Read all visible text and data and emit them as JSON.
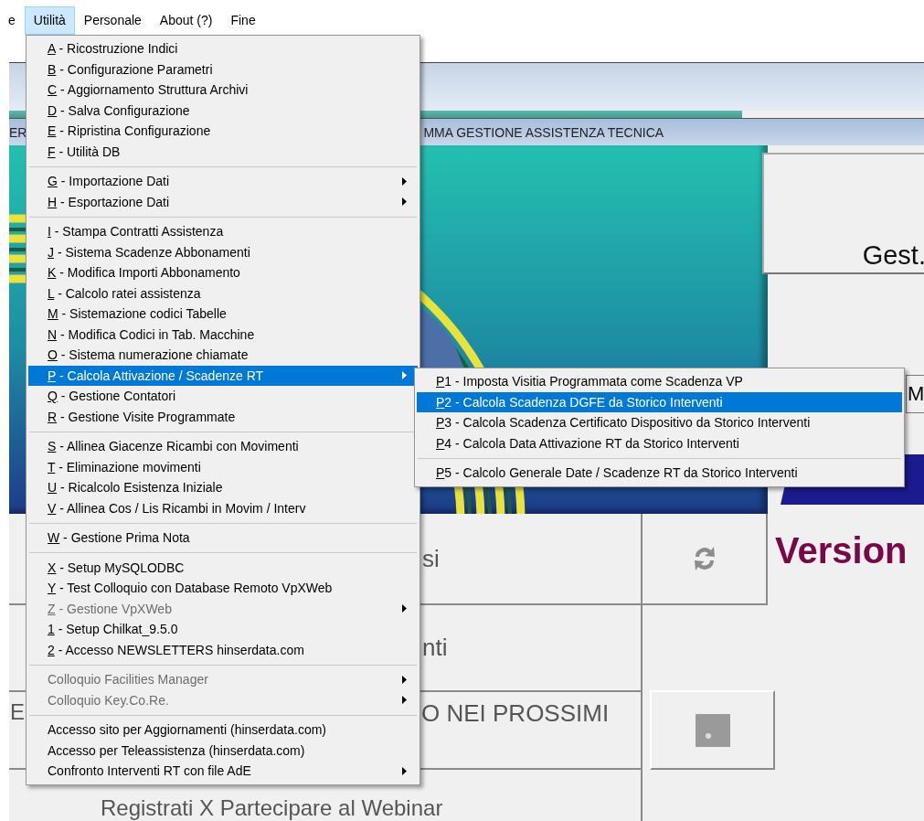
{
  "menubar": [
    {
      "label": "e",
      "selected": false
    },
    {
      "label": "Utilità",
      "selected": true
    },
    {
      "label": "Personale",
      "selected": false
    },
    {
      "label": "About (?)",
      "selected": false
    },
    {
      "label": "Fine",
      "selected": false
    }
  ],
  "background_window": {
    "title_left": "ER",
    "title_right": "MMA GESTIONE ASSISTENZA TECNICA",
    "panel_label": "Gest.",
    "side_label": "M",
    "version_label": "Version",
    "buttons": [
      {
        "kind": "text",
        "texts": [
          "si"
        ]
      },
      {
        "kind": "refresh"
      },
      {
        "kind": "text",
        "texts": [
          "nti"
        ]
      },
      {
        "kind": "text",
        "texts": [
          "E",
          "O NEI PROSSIMI"
        ]
      },
      {
        "kind": "picture"
      },
      {
        "kind": "text",
        "texts": [
          "Registrati X Partecipare al Webinar"
        ]
      }
    ]
  },
  "menu": {
    "items": [
      {
        "kind": "item",
        "label": "A - Ricostruzione Indici",
        "mnemonic": true,
        "disabled": false,
        "submenu": false,
        "selected": false
      },
      {
        "kind": "item",
        "label": "B - Configurazione Parametri",
        "mnemonic": true,
        "disabled": false,
        "submenu": false,
        "selected": false
      },
      {
        "kind": "item",
        "label": "C - Aggiornamento Struttura Archivi",
        "mnemonic": true,
        "disabled": false,
        "submenu": false,
        "selected": false
      },
      {
        "kind": "item",
        "label": "D - Salva Configurazione",
        "mnemonic": true,
        "disabled": false,
        "submenu": false,
        "selected": false
      },
      {
        "kind": "item",
        "label": "E - Ripristina Configurazione",
        "mnemonic": true,
        "disabled": false,
        "submenu": false,
        "selected": false
      },
      {
        "kind": "item",
        "label": "F - Utilità DB",
        "mnemonic": true,
        "disabled": false,
        "submenu": false,
        "selected": false
      },
      {
        "kind": "separator"
      },
      {
        "kind": "item",
        "label": "G - Importazione Dati",
        "mnemonic": true,
        "disabled": false,
        "submenu": true,
        "selected": false
      },
      {
        "kind": "item",
        "label": "H - Esportazione Dati",
        "mnemonic": true,
        "disabled": false,
        "submenu": true,
        "selected": false
      },
      {
        "kind": "separator"
      },
      {
        "kind": "item",
        "label": "I - Stampa Contratti Assistenza",
        "mnemonic": true,
        "disabled": false,
        "submenu": false,
        "selected": false
      },
      {
        "kind": "item",
        "label": "J - Sistema Scadenze Abbonamenti",
        "mnemonic": true,
        "disabled": false,
        "submenu": false,
        "selected": false
      },
      {
        "kind": "item",
        "label": "K - Modifica Importi Abbonamento",
        "mnemonic": true,
        "disabled": false,
        "submenu": false,
        "selected": false
      },
      {
        "kind": "item",
        "label": "L - Calcolo ratei assistenza",
        "mnemonic": true,
        "disabled": false,
        "submenu": false,
        "selected": false
      },
      {
        "kind": "item",
        "label": "M - Sistemazione codici Tabelle",
        "mnemonic": true,
        "disabled": false,
        "submenu": false,
        "selected": false
      },
      {
        "kind": "item",
        "label": "N - Modifica Codici in Tab. Macchine",
        "mnemonic": true,
        "disabled": false,
        "submenu": false,
        "selected": false
      },
      {
        "kind": "item",
        "label": "O - Sistema numerazione chiamate",
        "mnemonic": true,
        "disabled": false,
        "submenu": false,
        "selected": false
      },
      {
        "kind": "item",
        "label": "P - Calcola Attivazione / Scadenze RT",
        "mnemonic": true,
        "disabled": false,
        "submenu": true,
        "selected": true
      },
      {
        "kind": "item",
        "label": "Q - Gestione Contatori",
        "mnemonic": true,
        "disabled": false,
        "submenu": false,
        "selected": false
      },
      {
        "kind": "item",
        "label": "R - Gestione Visite Programmate",
        "mnemonic": true,
        "disabled": false,
        "submenu": false,
        "selected": false
      },
      {
        "kind": "separator"
      },
      {
        "kind": "item",
        "label": "S - Allinea Giacenze Ricambi con Movimenti",
        "mnemonic": true,
        "disabled": false,
        "submenu": false,
        "selected": false
      },
      {
        "kind": "item",
        "label": "T - Eliminazione movimenti",
        "mnemonic": true,
        "disabled": false,
        "submenu": false,
        "selected": false
      },
      {
        "kind": "item",
        "label": "U - Ricalcolo Esistenza Iniziale",
        "mnemonic": true,
        "disabled": false,
        "submenu": false,
        "selected": false
      },
      {
        "kind": "item",
        "label": "V - Allinea Cos / Lis Ricambi in Movim / Interv",
        "mnemonic": true,
        "disabled": false,
        "submenu": false,
        "selected": false
      },
      {
        "kind": "separator"
      },
      {
        "kind": "item",
        "label": "W - Gestione Prima Nota",
        "mnemonic": true,
        "disabled": false,
        "submenu": false,
        "selected": false
      },
      {
        "kind": "separator"
      },
      {
        "kind": "item",
        "label": "X - Setup MySQLODBC",
        "mnemonic": true,
        "disabled": false,
        "submenu": false,
        "selected": false
      },
      {
        "kind": "item",
        "label": "Y - Test Colloquio con Database Remoto VpXWeb",
        "mnemonic": true,
        "disabled": false,
        "submenu": false,
        "selected": false
      },
      {
        "kind": "item",
        "label": "Z - Gestione VpXWeb",
        "mnemonic": true,
        "disabled": true,
        "submenu": true,
        "selected": false
      },
      {
        "kind": "item",
        "label": "1 - Setup Chilkat_9.5.0",
        "mnemonic": true,
        "disabled": false,
        "submenu": false,
        "selected": false
      },
      {
        "kind": "item",
        "label": "2 - Accesso NEWSLETTERS hinserdata.com",
        "mnemonic": true,
        "disabled": false,
        "submenu": false,
        "selected": false
      },
      {
        "kind": "separator"
      },
      {
        "kind": "item",
        "label": "Colloquio Facilities Manager",
        "mnemonic": false,
        "disabled": true,
        "submenu": true,
        "selected": false
      },
      {
        "kind": "item",
        "label": "Colloquio Key.Co.Re.",
        "mnemonic": false,
        "disabled": true,
        "submenu": true,
        "selected": false
      },
      {
        "kind": "separator"
      },
      {
        "kind": "item",
        "label": "Accesso sito per Aggiornamenti (hinserdata.com)",
        "mnemonic": false,
        "disabled": false,
        "submenu": false,
        "selected": false
      },
      {
        "kind": "item",
        "label": "Accesso per Teleassistenza (hinserdata.com)",
        "mnemonic": false,
        "disabled": false,
        "submenu": false,
        "selected": false
      },
      {
        "kind": "item",
        "label": "Confronto Interventi RT con file  AdE",
        "mnemonic": false,
        "disabled": false,
        "submenu": true,
        "selected": false
      }
    ]
  },
  "submenu": {
    "items": [
      {
        "kind": "item",
        "label": "P1 - Imposta Visitia Programmata come Scadenza VP",
        "mnemonic": true,
        "disabled": false,
        "submenu": false,
        "selected": false
      },
      {
        "kind": "item",
        "label": "P2 - Calcola Scadenza DGFE da Storico Interventi",
        "mnemonic": true,
        "disabled": false,
        "submenu": false,
        "selected": true
      },
      {
        "kind": "item",
        "label": "P3 - Calcola Scadenza Certificato Dispositivo da Storico Interventi",
        "mnemonic": true,
        "disabled": false,
        "submenu": false,
        "selected": false
      },
      {
        "kind": "item",
        "label": "P4 - Calcola Data Attivazione RT da Storico Interventi",
        "mnemonic": true,
        "disabled": false,
        "submenu": false,
        "selected": false
      },
      {
        "kind": "separator"
      },
      {
        "kind": "item",
        "label": "P5 - Calcolo Generale Date / Scadenze RT da Storico Interventi",
        "mnemonic": true,
        "disabled": false,
        "submenu": false,
        "selected": false
      }
    ]
  }
}
